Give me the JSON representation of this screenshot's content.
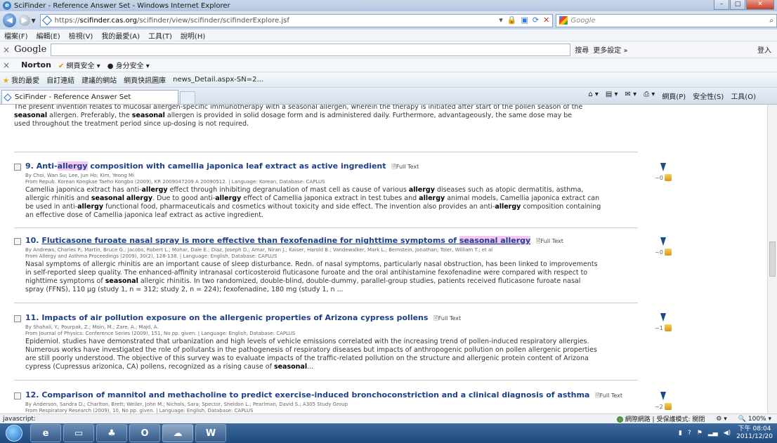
{
  "window": {
    "title": "SciFinder - Reference Answer Set - Windows Internet Explorer"
  },
  "address": {
    "url_prefix": "https://",
    "url_domain": "scifinder.cas.org",
    "url_path": "/scifinder/view/scifinder/scifinderExplore.jsf",
    "search_placeholder": "Google"
  },
  "menu": [
    "檔案(F)",
    "編輯(E)",
    "檢視(V)",
    "我的最愛(A)",
    "工具(T)",
    "說明(H)"
  ],
  "google_bar": {
    "logo": "Google",
    "search_btn": "搜尋",
    "more": "更多設定 »",
    "signin": "登入"
  },
  "norton_bar": {
    "brand": "Norton",
    "web_safety": "網頁安全",
    "identity": "身分安全"
  },
  "favorites_bar": {
    "favorites": "我的最愛",
    "items": [
      "自訂連結",
      "建議的網站",
      "網頁快訊圖庫",
      "news_Detail.aspx-SN=2..."
    ]
  },
  "tab": {
    "label": "SciFinder - Reference Answer Set"
  },
  "commands": [
    "網頁(P)",
    "安全性(S)",
    "工具(O)"
  ],
  "partial_top": {
    "line1": "The present invention relates to mucosal allergen-specific immunotherapy with a seasonal allergen, wherein the therapy is initiated after start of the pollen season of the",
    "line2_b1": "seasonal",
    "line2_t1": " allergen.  Preferably, the ",
    "line2_b2": "seasonal",
    "line2_t2": " allergen is provided in solid dosage form and is administered daily.  Furthermore, advantageously, the same dose may be",
    "line3": "used throughout the treatment period since up-dosing is not required."
  },
  "results": [
    {
      "num": "9.",
      "title_pre": "Anti-",
      "title_hl": "allergy",
      "title_post": " composition with camellia japonica leaf extract as active ingredient",
      "fulltext": "Full Text",
      "authors": "By Choi, Wan Su; Lee, Jun Ho; Kim, Yeong Mi",
      "source": "From Repub. Korean Kongkae Taeho Kongbo (2009), KR 2009047209 A 20090512.  | Language: Korean, Database: CAPLUS",
      "abstract": [
        "Camellia japonica extract has anti-allergy effect through inhibiting degranulation of mast cell as cause of various allergy diseases such as atopic dermatitis, asthma,",
        "allergic rhinitis and seasonal allergy.  Due to good anti-allergy effect of Camellia japonica extract in test tubes and allergy animal models, Camellia japonica extract can",
        "be used in anti-allergy functional food, pharmaceuticals and cosmetics without toxicity and side effect.  The invention also provides an anti-allergy composition containing",
        "an effective dose of Camellia japonica leaf extract as active ingredient."
      ],
      "cited": "~0"
    },
    {
      "num": "10.",
      "title": "Fluticasone furoate nasal spray is more effective than fexofenadine for nighttime symptoms of ",
      "title_hl": "seasonal allergy",
      "fulltext": "Full Text",
      "authors": "By Andrews, Charles P.; Martin, Bruce G.; Jacobs, Robert L.; Mohar, Dale E.; Diaz, Joseph D.; Amar, Niran J.; Kaiser, Harold B.; Vandewalker, Mark L.; Bernstein, Jonathan; Toler, William T.; et al",
      "source": "From Allergy and Asthma Proceedings (2009), 30(2), 128-138.  | Language: English, Database: CAPLUS",
      "abstract": [
        "Nasal symptoms of allergic rhinitis are an important cause of sleep disturbance.  Redn. of nasal symptoms, particularly nasal obstruction, has been linked to improvements",
        "in self-reported sleep quality.  The enhanced-affinity intranasal corticosteroid fluticasone furoate and the oral antihistamine fexofenadine were compared with respect to",
        "nighttime symptoms of seasonal allergic rhinitis.  In two randomized, double-blind, double-dummy, parallel-group studies, patients received fluticasone furoate nasal",
        "spray (FFNS), 110 μg (study 1, n = 312; study 2, n = 224); fexofenadine, 180 mg (study 1, n ..."
      ],
      "cited": "~0"
    },
    {
      "num": "11.",
      "title": "Impacts of air pollution exposure on the allergenic properties of Arizona cypress pollens",
      "fulltext": "Full Text",
      "authors": "By Shahali, Y.; Pourpak, Z.; Moin, M.; Zare, A.; Majd, A.",
      "source": "From Journal of Physics: Conference Series (2009), 151, No pp. given.  | Language: English, Database: CAPLUS",
      "abstract": [
        "Epidemiol. studies have demonstrated that urbanization and high levels of vehicle emissions correlated with the increasing trend of pollen-induced respiratory allergies.",
        "Numerous works have investigated the role of pollutants in the pathogenesis of respiratory diseases but impacts of anthropogenic pollution on pollen allergenic properties",
        "are still poorly understood.  The objective of this survey was to evaluate impacts of the traffic-related pollution on the structure and allergenic protein content of Arizona",
        "cypress (Cupressus arizonica, CA) pollens, recognized as a rising cause of seasonal..."
      ],
      "cited": "~1"
    },
    {
      "num": "12.",
      "title": "Comparison of mannitol and methacholine to predict exercise-induced bronchoconstriction and a clinical diagnosis of asthma",
      "fulltext": "Full Text",
      "authors": "By Anderson, Sandra D.; Charlton, Brett; Weiler, John M.; Nichols, Sara; Spector, Sheldon L.; Pearlman, David S.; A305 Study Group",
      "source": "From Respiratory Research (2009), 10, No pp. given.  | Language: English, Database: CAPLUS",
      "cited": "~2"
    }
  ],
  "status": {
    "left": "javascript:",
    "zone": "網際網路 | 受保護模式: 關閉",
    "zoom": "100%"
  },
  "clock": {
    "time": "下午 08:04",
    "date": "2011/12/20"
  }
}
